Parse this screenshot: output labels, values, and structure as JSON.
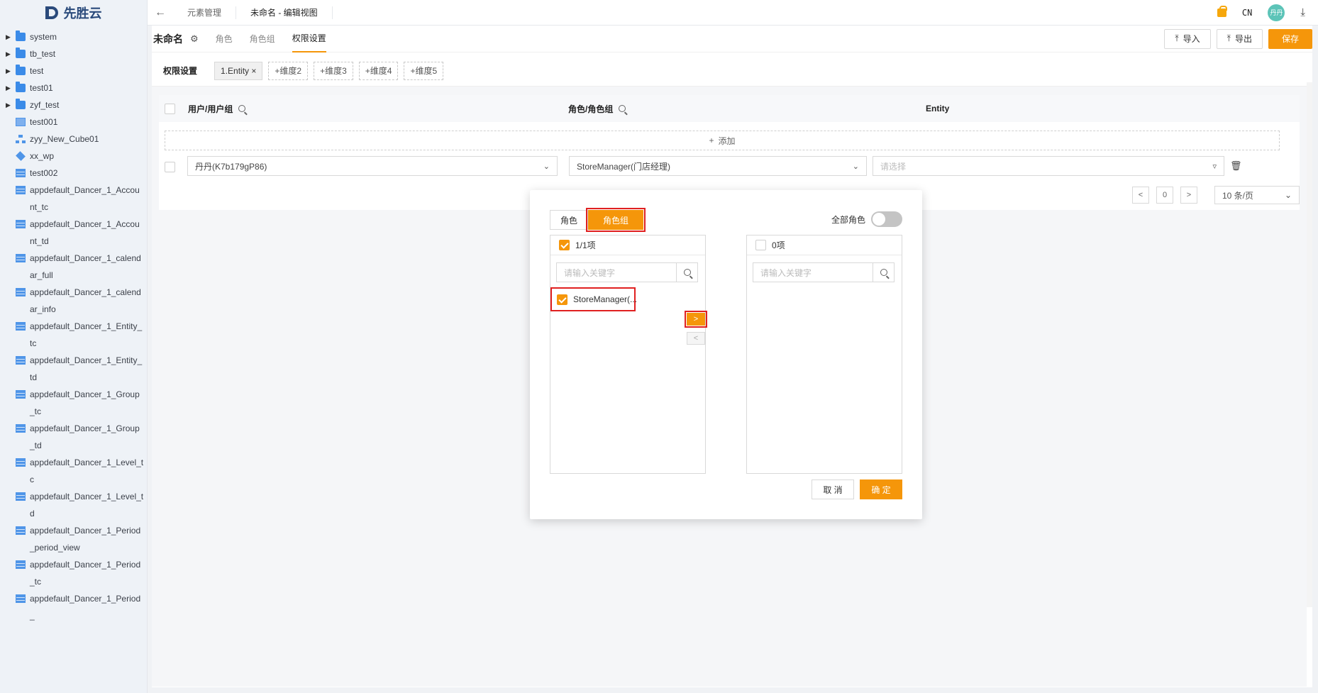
{
  "logo": {
    "text": "先胜云"
  },
  "sidebar": {
    "items": [
      {
        "label": "system",
        "icon": "folder-icon",
        "expandable": true
      },
      {
        "label": "tb_test",
        "icon": "folder-icon",
        "expandable": true
      },
      {
        "label": "test",
        "icon": "folder-icon",
        "expandable": true
      },
      {
        "label": "test01",
        "icon": "folder-icon",
        "expandable": true
      },
      {
        "label": "zyf_test",
        "icon": "folder-icon",
        "expandable": true
      },
      {
        "label": "test001",
        "icon": "file-icon",
        "expandable": false
      },
      {
        "label": "zyy_New_Cube01",
        "icon": "tree-icon",
        "expandable": false
      },
      {
        "label": "xx_wp",
        "icon": "cube-icon",
        "expandable": false
      },
      {
        "label": "test002",
        "icon": "table-icon",
        "expandable": false
      },
      {
        "label": "appdefault_Dancer_1_Account_tc",
        "icon": "table-icon",
        "expandable": false
      },
      {
        "label": "appdefault_Dancer_1_Account_td",
        "icon": "table-icon",
        "expandable": false
      },
      {
        "label": "appdefault_Dancer_1_calendar_full",
        "icon": "table-icon",
        "expandable": false
      },
      {
        "label": "appdefault_Dancer_1_calendar_info",
        "icon": "table-icon",
        "expandable": false
      },
      {
        "label": "appdefault_Dancer_1_Entity_tc",
        "icon": "table-icon",
        "expandable": false
      },
      {
        "label": "appdefault_Dancer_1_Entity_td",
        "icon": "table-icon",
        "expandable": false
      },
      {
        "label": "appdefault_Dancer_1_Group_tc",
        "icon": "table-icon",
        "expandable": false
      },
      {
        "label": "appdefault_Dancer_1_Group_td",
        "icon": "table-icon",
        "expandable": false
      },
      {
        "label": "appdefault_Dancer_1_Level_tc",
        "icon": "table-icon",
        "expandable": false
      },
      {
        "label": "appdefault_Dancer_1_Level_td",
        "icon": "table-icon",
        "expandable": false
      },
      {
        "label": "appdefault_Dancer_1_Period_period_view",
        "icon": "table-icon",
        "expandable": false
      },
      {
        "label": "appdefault_Dancer_1_Period_tc",
        "icon": "table-icon",
        "expandable": false
      },
      {
        "label": "appdefault_Dancer_1_Period_",
        "icon": "table-icon",
        "expandable": false
      }
    ]
  },
  "topbar": {
    "crumbs": [
      "元素管理",
      "未命名 - 编辑视图"
    ],
    "lang": "CN",
    "avatar": "丹丹"
  },
  "view": {
    "title": "未命名",
    "tabs": [
      "角色",
      "角色组",
      "权限设置"
    ],
    "active_tab": "权限设置",
    "import_label": "导入",
    "export_label": "导出",
    "save_label": "保存"
  },
  "dimensions": {
    "title": "权限设置",
    "chips": [
      "1.Entity",
      "+维度2",
      "+维度3",
      "+维度4",
      "+维度5"
    ]
  },
  "table": {
    "headers": [
      "用户/用户组",
      "角色/角色组",
      "Entity"
    ],
    "add_label": "添加",
    "row": {
      "user": "丹丹(K7b179gP86)",
      "role": "StoreManager(门店经理)",
      "entity_placeholder": "请选择"
    },
    "pager": {
      "page": "0",
      "page_size": "10 条/页"
    }
  },
  "popup": {
    "seg_role": "角色",
    "seg_role_group": "角色组",
    "all_roles_label": "全部角色",
    "left": {
      "count": "1/1项",
      "placeholder": "请输入关键字",
      "items": [
        "StoreManager(..."
      ]
    },
    "right": {
      "count": "0项",
      "placeholder": "请输入关键字"
    },
    "cancel_label": "取 消",
    "confirm_label": "确 定"
  },
  "colors": {
    "accent": "#f5960a",
    "highlight": "#e02020",
    "brand": "#2a4a7b"
  }
}
